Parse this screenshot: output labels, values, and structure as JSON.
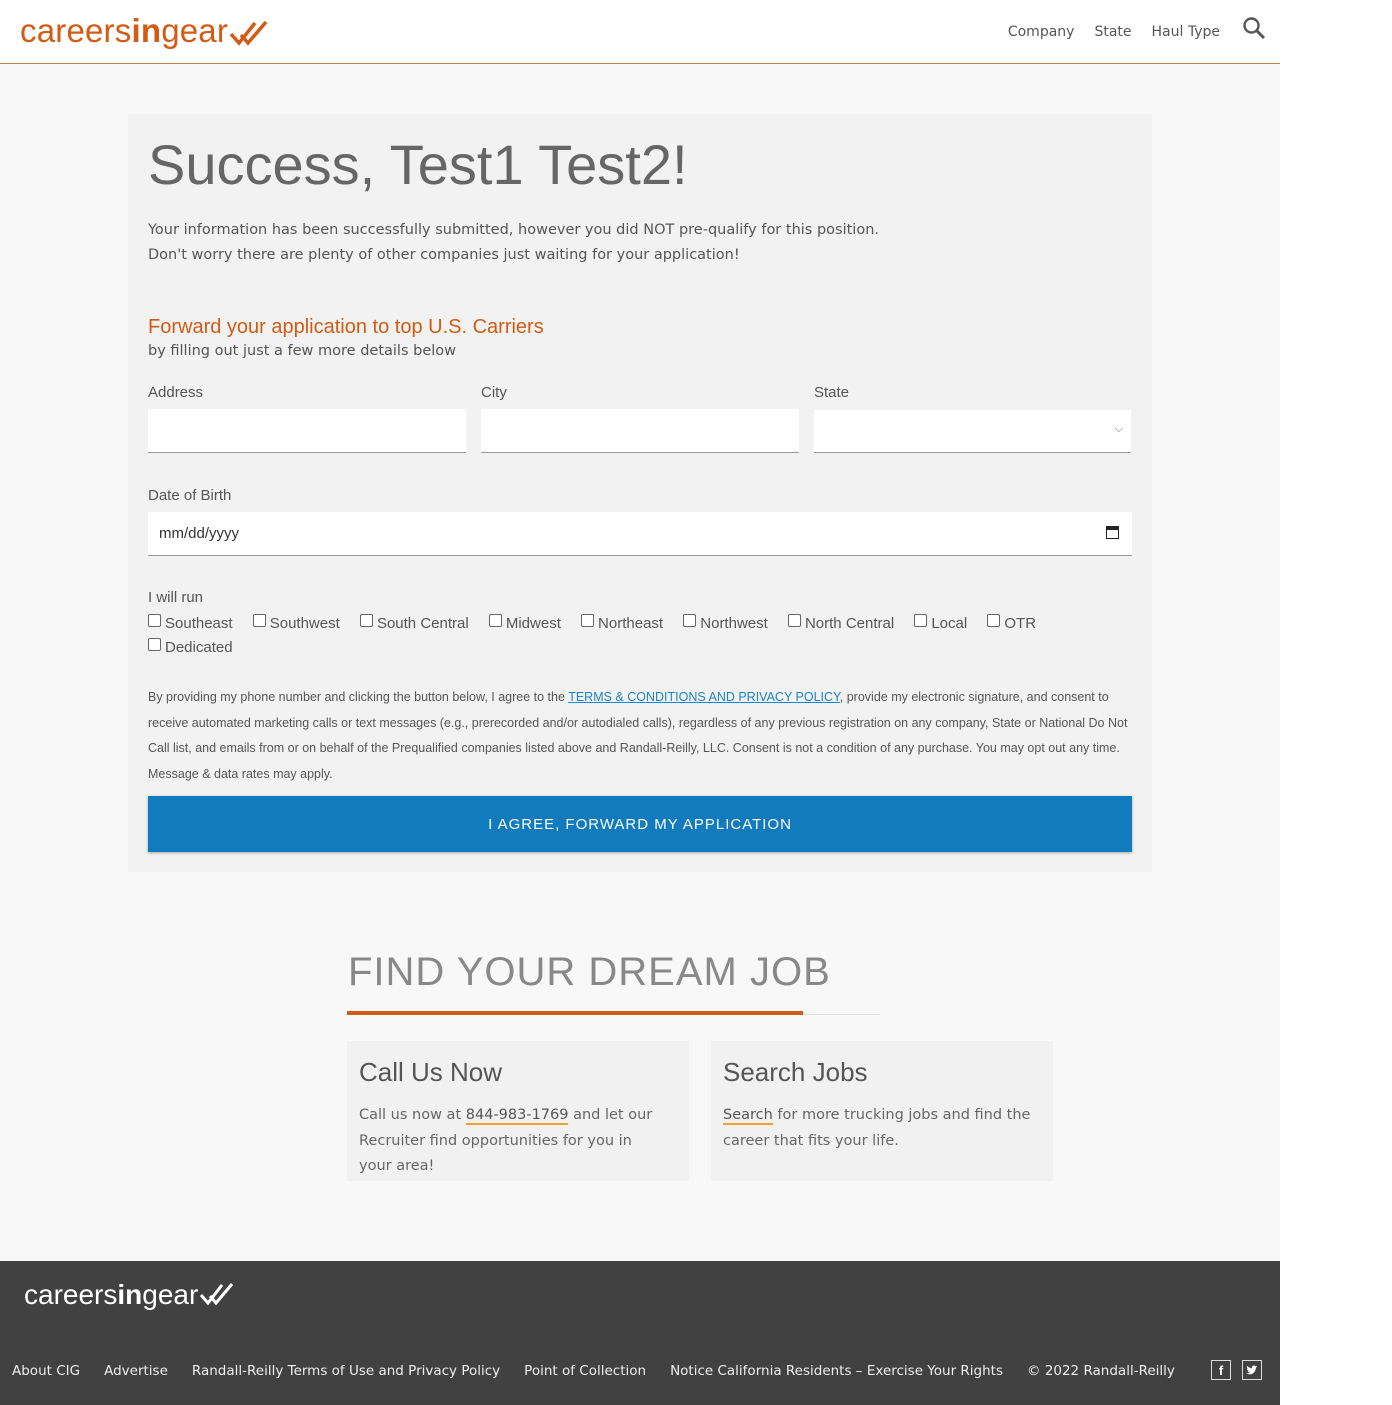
{
  "header": {
    "logo": {
      "pre": "careers",
      "bold": "in",
      "post": "gear"
    },
    "nav": [
      "Company",
      "State",
      "Haul Type"
    ],
    "search_icon": "search-icon"
  },
  "card": {
    "title": "Success, Test1 Test2!",
    "intro_line1": "Your information has been successfully submitted, however you did NOT pre-qualify for this position.",
    "intro_line2": "Don't worry there are plenty of other companies just waiting for your application!",
    "forward_title": "Forward your application to top U.S. Carriers",
    "forward_sub": "by filling out just a few more details below",
    "address_label": "Address",
    "address_value": "",
    "city_label": "City",
    "city_value": "",
    "state_label": "State",
    "state_value": "",
    "dob_label": "Date of Birth",
    "dob_placeholder": "mm/dd/yyyy",
    "run_label": "I will run",
    "run_options": [
      "Southeast",
      "Southwest",
      "South Central",
      "Midwest",
      "Northeast",
      "Northwest",
      "North Central",
      "Local",
      "OTR",
      "Dedicated"
    ],
    "legal_pre": "By providing my phone number and clicking the button below, I agree to the ",
    "legal_link": "TERMS & CONDITIONS AND PRIVACY POLICY",
    "legal_post": ", provide my electronic signature, and consent to receive automated marketing calls or text messages (e.g., prerecorded and/or autodialed calls), regardless of any previous registration on any company, State or National Do Not Call list, and emails from or on behalf of the Prequalified companies listed above and Randall-Reilly, LLC. Consent is not a condition of any purchase. You may opt out any time. Message & data rates may apply.",
    "agree_button": "I AGREE, FORWARD MY APPLICATION"
  },
  "dream": {
    "title": "FIND YOUR DREAM JOB",
    "call": {
      "heading": "Call Us Now",
      "pre": "Call us now at ",
      "phone": "844-983-1769",
      "post": " and let our Recruiter find opportunities for you in your area!"
    },
    "search": {
      "heading": "Search Jobs",
      "link": "Search",
      "post": " for more trucking jobs and find the career that fits your life."
    }
  },
  "footer": {
    "logo": {
      "pre": "careers",
      "bold": "in",
      "post": "gear"
    },
    "links": [
      "About CIG",
      "Advertise",
      "Randall-Reilly Terms of Use and Privacy Policy",
      "Point of Collection",
      "Notice California Residents – Exercise Your Rights"
    ],
    "copyright": "© 2022 Randall-Reilly",
    "social_icons": [
      "facebook-icon",
      "twitter-icon"
    ]
  },
  "colors": {
    "brand_orange": "#d35b13",
    "button_blue": "#127bbd",
    "footer_bg": "#414141"
  }
}
